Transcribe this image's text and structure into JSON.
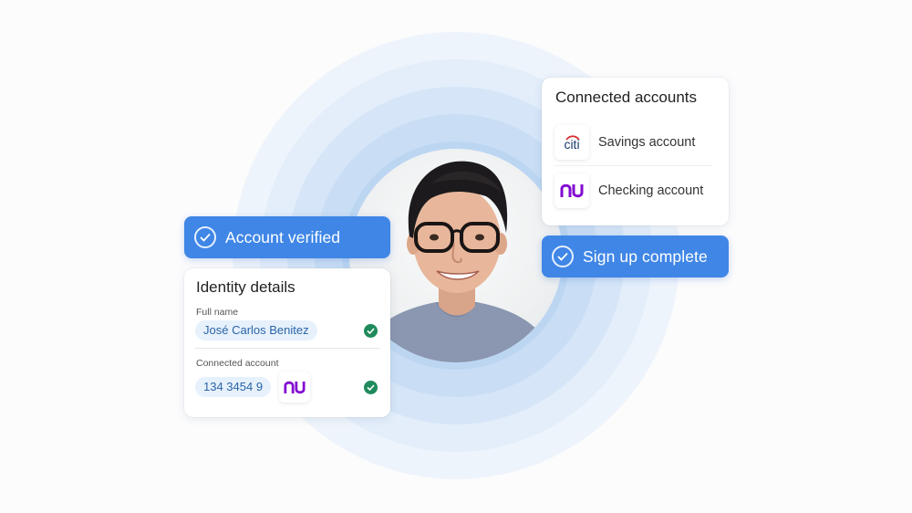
{
  "connected_accounts": {
    "title": "Connected accounts",
    "accounts": [
      {
        "bank": "citi",
        "logo_text": "citi",
        "label": "Savings account",
        "logo_color": "#1b3a6b",
        "arc_color": "#d62e2e"
      },
      {
        "bank": "nu",
        "logo_text": "nu",
        "label": "Checking account",
        "logo_color": "#820ad1"
      }
    ]
  },
  "banners": {
    "account_verified": "Account verified",
    "sign_up_complete": "Sign up complete"
  },
  "identity": {
    "title": "Identity details",
    "full_name_label": "Full name",
    "full_name_value": "José Carlos Benitez",
    "connected_account_label": "Connected account",
    "connected_account_value": "134 3454 9",
    "connected_account_bank": "nu"
  },
  "colors": {
    "accent_blue": "#3f86e6",
    "check_green": "#1f8a5b",
    "pill_bg": "#e6f1fc",
    "pill_text": "#2c64a8",
    "nu_purple": "#820ad1"
  }
}
